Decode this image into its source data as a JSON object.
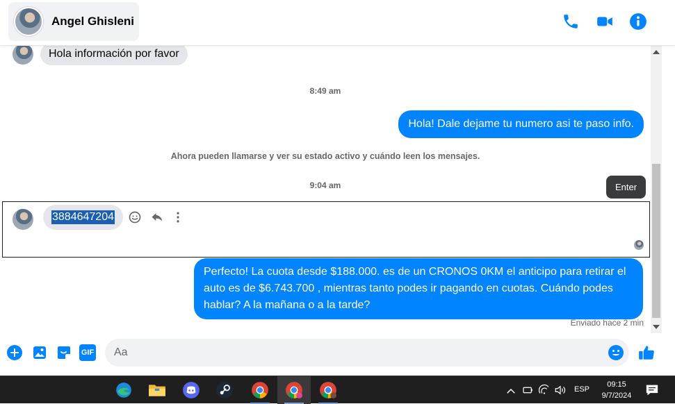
{
  "header": {
    "contact_name": "Angel Ghisleni",
    "icons": [
      "phone-icon",
      "video-camera-icon",
      "info-icon"
    ],
    "accent_color": "#0084ff"
  },
  "messages": {
    "incoming_1": "Hola información por favor",
    "timestamp_1": "8:49 am",
    "outgoing_1": "Hola! Dale dejame tu numero  asi te paso info.",
    "system_note": "Ahora pueden llamarse y ver su estado activo y cuándo leen los mensajes.",
    "timestamp_2": "9:04 am",
    "tooltip": "Enter",
    "incoming_2_selected": "3884647204",
    "outgoing_2": "Perfecto! La cuota desde $188.000. es de un CRONOS 0KM el anticipo para retirar el auto es de $6.743.700 , mientras tanto podes ir pagando en cuotas. Cuándo podes hablar? A la mañana o a la tarde?",
    "sent_status": "Enviado hace 2 min"
  },
  "composer": {
    "placeholder": "Aa",
    "value": "",
    "icons": [
      "plus-icon",
      "image-icon",
      "sticker-icon",
      "gif-icon",
      "emoji-icon",
      "like-icon"
    ],
    "gif_label": "GIF"
  },
  "taskbar": {
    "apps": [
      "edge-icon",
      "file-explorer-icon",
      "discord-icon",
      "steam-icon",
      "chrome-icon",
      "chrome-icon",
      "chrome-icon"
    ],
    "language": "ESP",
    "time": "09:15",
    "date": "9/7/2024"
  }
}
